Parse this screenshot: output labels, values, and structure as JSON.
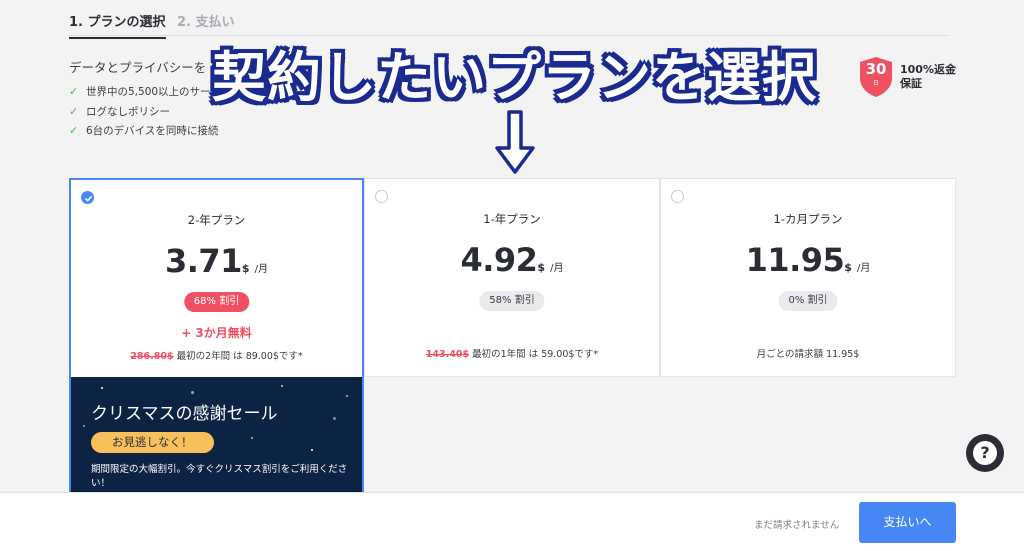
{
  "steps": {
    "step1": "1. プランの選択",
    "step2": "2. 支払い"
  },
  "intro": {
    "text": "データとプライバシーを"
  },
  "features": [
    "世界中の5,500以上のサーバ",
    "ログなしポリシー",
    "6台のデバイスを同時に接続"
  ],
  "overlay": {
    "title": "契約したいプランを選択",
    "arrow": "down-arrow"
  },
  "guarantee": {
    "days": "30",
    "days_sub": "日",
    "label_line1": "100%返金",
    "label_line2": "保証"
  },
  "plans": [
    {
      "name": "2-年プラン",
      "price": "3.71",
      "unit": "$",
      "per": "/月",
      "badge": "68% 割引",
      "bonus": "+ 3か月無料",
      "original": "286.80$",
      "note": "最初の2年間 は 89.00$です*",
      "selected": true
    },
    {
      "name": "1-年プラン",
      "price": "4.92",
      "unit": "$",
      "per": "/月",
      "badge": "58% 割引",
      "original": "143.40$",
      "note": "最初の1年間 は 59.00$です*",
      "selected": false
    },
    {
      "name": "1-カ月プラン",
      "price": "11.95",
      "unit": "$",
      "per": "/月",
      "badge": "0% 割引",
      "note": "月ごとの請求額 11.95$",
      "selected": false
    }
  ],
  "promo": {
    "title": "クリスマスの感謝セール",
    "button": "お見逃しなく！",
    "desc": "期間限定の大幅割引。今すぐクリスマス割引をご利用ください！"
  },
  "help": {
    "icon": "question-icon",
    "glyph": "?"
  },
  "footer": {
    "note": "まだ請求されません",
    "pay_button": "支払いへ"
  },
  "colors": {
    "accent": "#4687f4",
    "sale": "#ef5162",
    "promo_bg": "#0d2344",
    "promo_button": "#f7c05a",
    "check": "#4bb34b",
    "overlay_outline": "#1b2a8f"
  }
}
